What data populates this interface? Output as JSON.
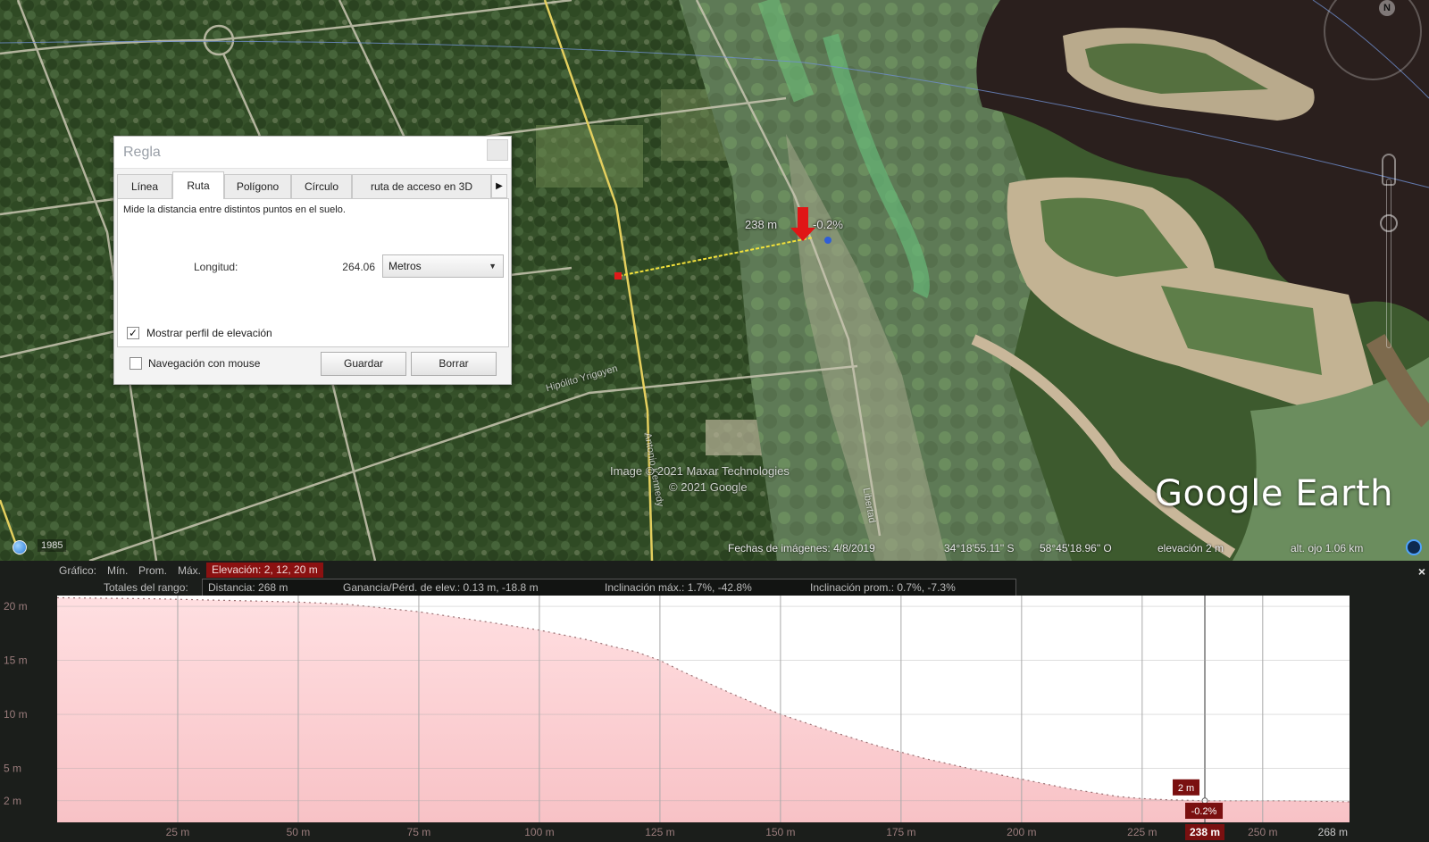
{
  "map": {
    "streets": [
      "Hipólito Yrigoyen",
      "Antonio Kennedy",
      "Libertad"
    ],
    "measure_labels": {
      "distance": "238 m",
      "slope": "-0.2%"
    },
    "credits": [
      "Image © 2021 Maxar Technologies",
      "© 2021 Google"
    ],
    "logo": "Google Earth",
    "history_year": "1985",
    "compass_label": "N",
    "status": {
      "imagery_date": "Fechas de imágenes: 4/8/2019",
      "latitude": "34°18'55.11\" S",
      "longitude": "58°45'18.96\" O",
      "elevation": "elevación     2 m",
      "eye_alt": "alt. ojo   1.06 km"
    }
  },
  "ruler": {
    "title": "Regla",
    "tabs": [
      "Línea",
      "Ruta",
      "Polígono",
      "Círculo",
      "ruta de acceso en 3D"
    ],
    "active_tab": "Ruta",
    "description": "Mide la distancia entre distintos puntos en el suelo.",
    "length_label": "Longitud:",
    "length_value": "264.06",
    "unit": "Metros",
    "show_elevation_label": "Mostrar perfil de elevación",
    "show_elevation_checked": true,
    "mouse_nav_label": "Navegación con mouse",
    "mouse_nav_checked": false,
    "save_label": "Guardar",
    "clear_label": "Borrar"
  },
  "profile": {
    "graph_label": "Gráfico:",
    "stats_labels": [
      "Mín.",
      "Prom.",
      "Máx."
    ],
    "elevation_badge": "Elevación: 2, 12, 20 m",
    "range_totals_label": "Totales del rango:",
    "range_distance": "Distancia: 268 m",
    "range_gain": "Ganancia/Pérd. de elev.: 0.13 m, -18.8 m",
    "range_max_slope": "Inclinación máx.: 1.7%, -42.8%",
    "range_avg_slope": "Inclinación prom.: 0.7%, -7.3%",
    "close_label": "×",
    "cursor_elev_label": "2 m",
    "cursor_slope_label": "-0.2%",
    "cursor_dist_label": "238 m"
  },
  "chart_data": {
    "type": "area",
    "title": "",
    "xlabel": "",
    "ylabel": "",
    "xlim": [
      0,
      268
    ],
    "ylim": [
      0,
      21
    ],
    "x_ticks": [
      25,
      50,
      75,
      100,
      125,
      150,
      175,
      200,
      225,
      250
    ],
    "x_tick_labels": [
      "25 m",
      "50 m",
      "75 m",
      "100 m",
      "125 m",
      "150 m",
      "175 m",
      "200 m",
      "225 m",
      "250 m"
    ],
    "x_end_label": "268 m",
    "y_ticks": [
      2,
      5,
      10,
      15,
      20
    ],
    "y_tick_labels": [
      "2 m",
      "5 m",
      "10 m",
      "15 m",
      "20 m"
    ],
    "grid": true,
    "cursor_x": 238,
    "series": [
      {
        "x": [
          0,
          20,
          40,
          50,
          60,
          75,
          90,
          100,
          110,
          115,
          120,
          125,
          130,
          140,
          150,
          160,
          170,
          180,
          190,
          200,
          210,
          220,
          225,
          230,
          238,
          245,
          255,
          268
        ],
        "values": [
          20.8,
          20.7,
          20.5,
          20.4,
          20.2,
          19.5,
          18.5,
          17.8,
          16.9,
          16.3,
          15.8,
          15.0,
          13.9,
          11.9,
          10.0,
          8.5,
          7.1,
          5.9,
          4.9,
          4.0,
          3.1,
          2.4,
          2.2,
          2.1,
          2.0,
          2.0,
          2.0,
          1.9
        ]
      }
    ],
    "colors": {
      "fill": "#f8c2c6",
      "fill_top": "#ffdfe1",
      "grid": "#a9a9a9",
      "plot_bg": "#ffffff"
    }
  }
}
